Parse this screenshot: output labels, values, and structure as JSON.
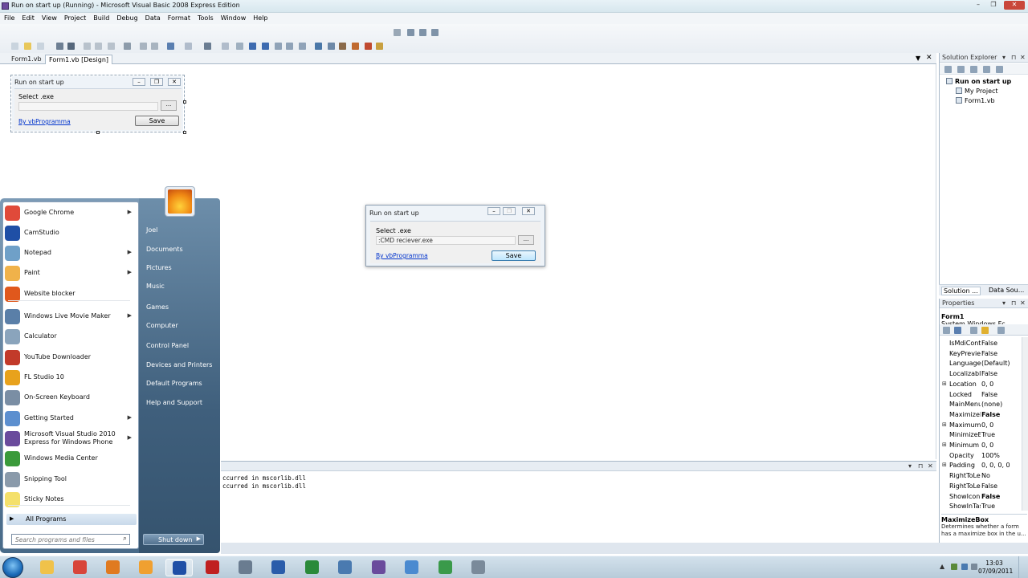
{
  "window": {
    "title": "Run on start up (Running) - Microsoft Visual Basic 2008 Express Edition",
    "controls": [
      "–",
      "❐",
      "✕"
    ]
  },
  "menu": [
    "File",
    "Edit",
    "View",
    "Project",
    "Build",
    "Debug",
    "Data",
    "Format",
    "Tools",
    "Window",
    "Help"
  ],
  "doc_tabs": {
    "tab1": "Form1.vb",
    "tab2": "Form1.vb [Design]"
  },
  "design_form": {
    "title": "Run on start up",
    "select_label": "Select .exe",
    "path_value": "",
    "browse_label": "...",
    "link": "By vbProgramma",
    "save_label": "Save"
  },
  "running_form": {
    "title": "Run on start up",
    "select_label": "Select .exe",
    "path_value": ":CMD reciever.exe",
    "browse_label": "...",
    "link": "By vbProgramma",
    "save_label": "Save"
  },
  "output": {
    "lines": [
      "ccurred in mscorlib.dll",
      "ccurred in mscorlib.dll"
    ]
  },
  "solution_explorer": {
    "title": "Solution Explorer",
    "root": "Run on start up",
    "items": [
      "My Project",
      "Form1.vb"
    ],
    "tab1": "Solution ...",
    "tab2": "Data Sou..."
  },
  "properties": {
    "title": "Properties",
    "object_name": "Form1",
    "object_type": "System.Windows.Fc",
    "rows": [
      {
        "name": "IsMdiCont",
        "value": "False",
        "expand": "",
        "bold": false
      },
      {
        "name": "KeyPreviev",
        "value": "False",
        "expand": "",
        "bold": false
      },
      {
        "name": "Language",
        "value": "(Default)",
        "expand": "",
        "bold": false
      },
      {
        "name": "Localizable",
        "value": "False",
        "expand": "",
        "bold": false
      },
      {
        "name": "Location",
        "value": "0, 0",
        "expand": "⊞",
        "bold": false
      },
      {
        "name": "Locked",
        "value": "False",
        "expand": "",
        "bold": false
      },
      {
        "name": "MainMenu",
        "value": "(none)",
        "expand": "",
        "bold": false
      },
      {
        "name": "MaximizeB",
        "value": "False",
        "expand": "",
        "bold": true
      },
      {
        "name": "Maximum",
        "value": "0, 0",
        "expand": "⊞",
        "bold": false
      },
      {
        "name": "MinimizeB",
        "value": "True",
        "expand": "",
        "bold": false
      },
      {
        "name": "Minimum",
        "value": "0, 0",
        "expand": "⊞",
        "bold": false
      },
      {
        "name": "Opacity",
        "value": "100%",
        "expand": "",
        "bold": false
      },
      {
        "name": "Padding",
        "value": "0, 0, 0, 0",
        "expand": "⊞",
        "bold": false
      },
      {
        "name": "RightToLe",
        "value": "No",
        "expand": "",
        "bold": false
      },
      {
        "name": "RightToLe",
        "value": "False",
        "expand": "",
        "bold": false
      },
      {
        "name": "ShowIcon",
        "value": "False",
        "expand": "",
        "bold": true
      },
      {
        "name": "ShowInTas",
        "value": "True",
        "expand": "",
        "bold": false
      }
    ],
    "desc_title": "MaximizeBox",
    "desc_text": "Determines whether a form has a maximize box in the u..."
  },
  "start_menu": {
    "programs": [
      {
        "label": "Google Chrome",
        "arrow": "▶",
        "color": "#e04a3a"
      },
      {
        "label": "CamStudio",
        "arrow": "",
        "color": "#1f4fa6"
      },
      {
        "label": "Notepad",
        "arrow": "▶",
        "color": "#6fa0c8"
      },
      {
        "label": "Paint",
        "arrow": "▶",
        "color": "#f0b24a"
      },
      {
        "label": "Website blocker",
        "arrow": "",
        "color": "#e0581c"
      },
      {
        "label": "Windows Live Movie Maker",
        "arrow": "▶",
        "color": "#5a7fa8"
      },
      {
        "label": "Calculator",
        "arrow": "",
        "color": "#8aa4bc"
      },
      {
        "label": "YouTube Downloader",
        "arrow": "",
        "color": "#c23a2a"
      },
      {
        "label": "FL Studio 10",
        "arrow": "",
        "color": "#e8a21c"
      },
      {
        "label": "On-Screen Keyboard",
        "arrow": "",
        "color": "#7a8ea4"
      },
      {
        "label": "Getting Started",
        "arrow": "▶",
        "color": "#5c8fcf"
      },
      {
        "label": "Microsoft Visual Studio 2010",
        "label2": "Express for Windows Phone",
        "arrow": "▶",
        "color": "#6a4b9c"
      },
      {
        "label": "Windows Media Center",
        "arrow": "",
        "color": "#3a9a3a"
      },
      {
        "label": "Snipping Tool",
        "arrow": "",
        "color": "#8a9aaa"
      },
      {
        "label": "Sticky Notes",
        "arrow": "",
        "color": "#f4e06a"
      }
    ],
    "all_programs": "All Programs",
    "search_placeholder": "Search programs and files",
    "right_items": [
      "Joel",
      "Documents",
      "Pictures",
      "Music",
      "Games",
      "Computer",
      "Control Panel",
      "Devices and Printers",
      "Default Programs",
      "Help and Support"
    ],
    "shutdown": "Shut down"
  },
  "taskbar": {
    "time": "13:03",
    "date": "07/09/2011",
    "apps": [
      {
        "name": "explorer",
        "color": "#f0c24a"
      },
      {
        "name": "chrome",
        "color": "#d8453a"
      },
      {
        "name": "app",
        "color": "#e07a20"
      },
      {
        "name": "media",
        "color": "#f0a030"
      },
      {
        "name": "camstudio",
        "color": "#1f4fa6"
      },
      {
        "name": "filezilla",
        "color": "#c02020"
      },
      {
        "name": "tool",
        "color": "#6a7c90"
      },
      {
        "name": "word",
        "color": "#2a5caa"
      },
      {
        "name": "excel",
        "color": "#2a8a3a"
      },
      {
        "name": "search",
        "color": "#4a7ab0"
      },
      {
        "name": "vb",
        "color": "#6a4b9c"
      },
      {
        "name": "run",
        "color": "#4a8ad0"
      },
      {
        "name": "network",
        "color": "#3a9a4a"
      },
      {
        "name": "mdi",
        "color": "#7a8a9a"
      }
    ]
  }
}
